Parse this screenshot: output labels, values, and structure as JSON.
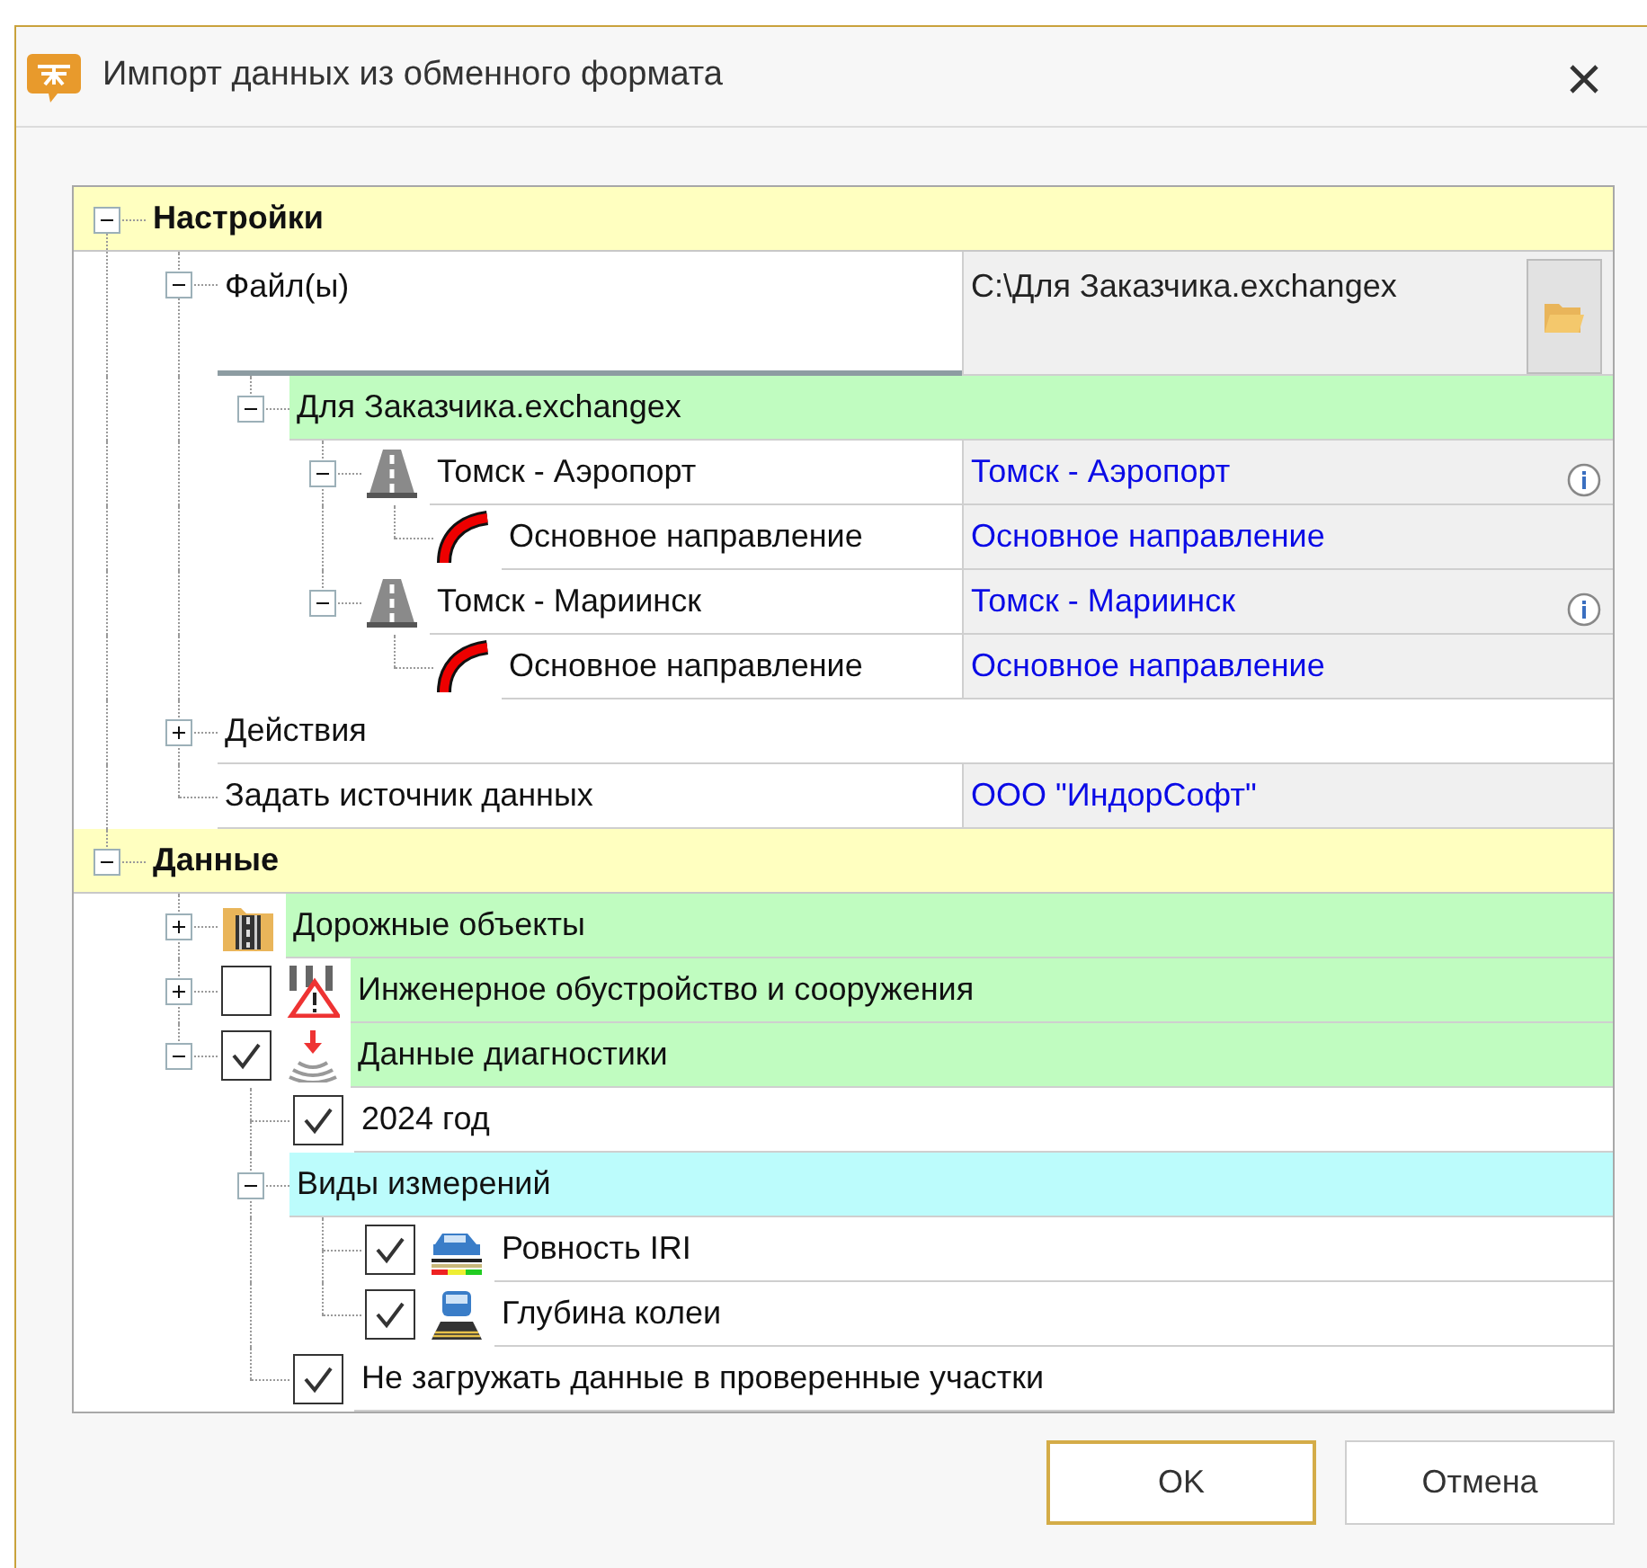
{
  "window": {
    "title": "Импорт данных из обменного формата"
  },
  "sections": [
    {
      "title": "Настройки",
      "expanded": true,
      "items": [
        {
          "label": "Файл(ы)",
          "kind": "file",
          "expanded": true,
          "value": "C:\\Для Заказчика.exchangex",
          "children": [
            {
              "label": "Для Заказчика.exchangex",
              "expanded": true,
              "color": "#c0fcc0",
              "children": [
                {
                  "label": "Томск - Аэропорт",
                  "kind": "road",
                  "expanded": true,
                  "value": "Томск - Аэропорт",
                  "children": [
                    {
                      "label": "Основное направление",
                      "kind": "direction",
                      "value": "Основное направление"
                    }
                  ]
                },
                {
                  "label": "Томск - Мариинск",
                  "kind": "road",
                  "expanded": true,
                  "value": "Томск - Мариинск",
                  "children": [
                    {
                      "label": "Основное направление",
                      "kind": "direction",
                      "value": "Основное направление"
                    }
                  ]
                }
              ]
            }
          ]
        },
        {
          "label": "Действия",
          "expanded": false
        },
        {
          "label": "Задать источник данных",
          "value": "ООО \"ИндорСофт\""
        }
      ]
    },
    {
      "title": "Данные",
      "expanded": true,
      "items": [
        {
          "label": "Дорожные объекты",
          "kind": "road-objects",
          "expanded": false,
          "color": "#c0fcc0"
        },
        {
          "label": "Инженерное обустройство и сооружения",
          "kind": "engineering",
          "expanded": false,
          "checked": false,
          "color": "#c0fcc0"
        },
        {
          "label": "Данные диагностики",
          "kind": "diagnostics",
          "expanded": true,
          "checked": true,
          "color": "#c0fcc0",
          "children": [
            {
              "label": "2024 год",
              "checked": true
            },
            {
              "label": "Виды измерений",
              "expanded": true,
              "color": "#bcfcfc",
              "children": [
                {
                  "label": "Ровность IRI",
                  "kind": "evenness",
                  "checked": true
                },
                {
                  "label": "Глубина колеи",
                  "kind": "rut",
                  "checked": true
                }
              ]
            },
            {
              "label": "Не загружать данные в проверенные участки",
              "checked": true
            }
          ]
        }
      ]
    }
  ],
  "buttons": [
    {
      "label": "OK",
      "default": true
    },
    {
      "label": "Отмена",
      "default": false
    }
  ]
}
